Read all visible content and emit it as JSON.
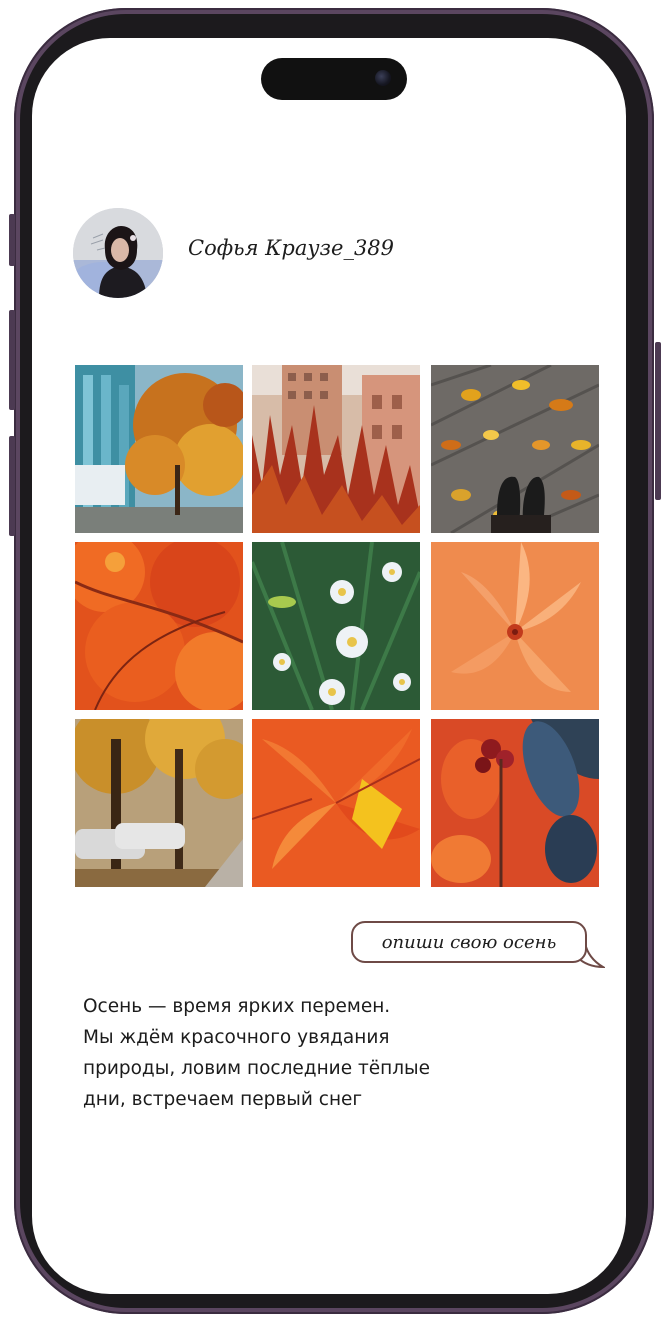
{
  "profile": {
    "username": "Софья Краузе_389",
    "avatar_icon": "user-avatar-photo"
  },
  "gallery": {
    "photos": [
      {
        "id": "autumn-street-building"
      },
      {
        "id": "red-shrubs-buildings"
      },
      {
        "id": "leaves-on-pavement-shoes"
      },
      {
        "id": "orange-tree-canopy"
      },
      {
        "id": "white-asters-flowers"
      },
      {
        "id": "orange-leaf-closeup"
      },
      {
        "id": "street-trees-cars"
      },
      {
        "id": "red-yellow-leaves"
      },
      {
        "id": "red-berries-dark-leaves"
      }
    ]
  },
  "prompt_bubble": {
    "text": "опиши свою осень"
  },
  "caption": {
    "lines": [
      "Осень — время ярких перемен.",
      "Мы ждём красочного увядания",
      "природы, ловим последние тёплые",
      "дни, встречаем первый снег"
    ]
  },
  "colors": {
    "frame": "#5b4660",
    "bubble_border": "#6e4a46",
    "text": "#1c1c1c"
  }
}
